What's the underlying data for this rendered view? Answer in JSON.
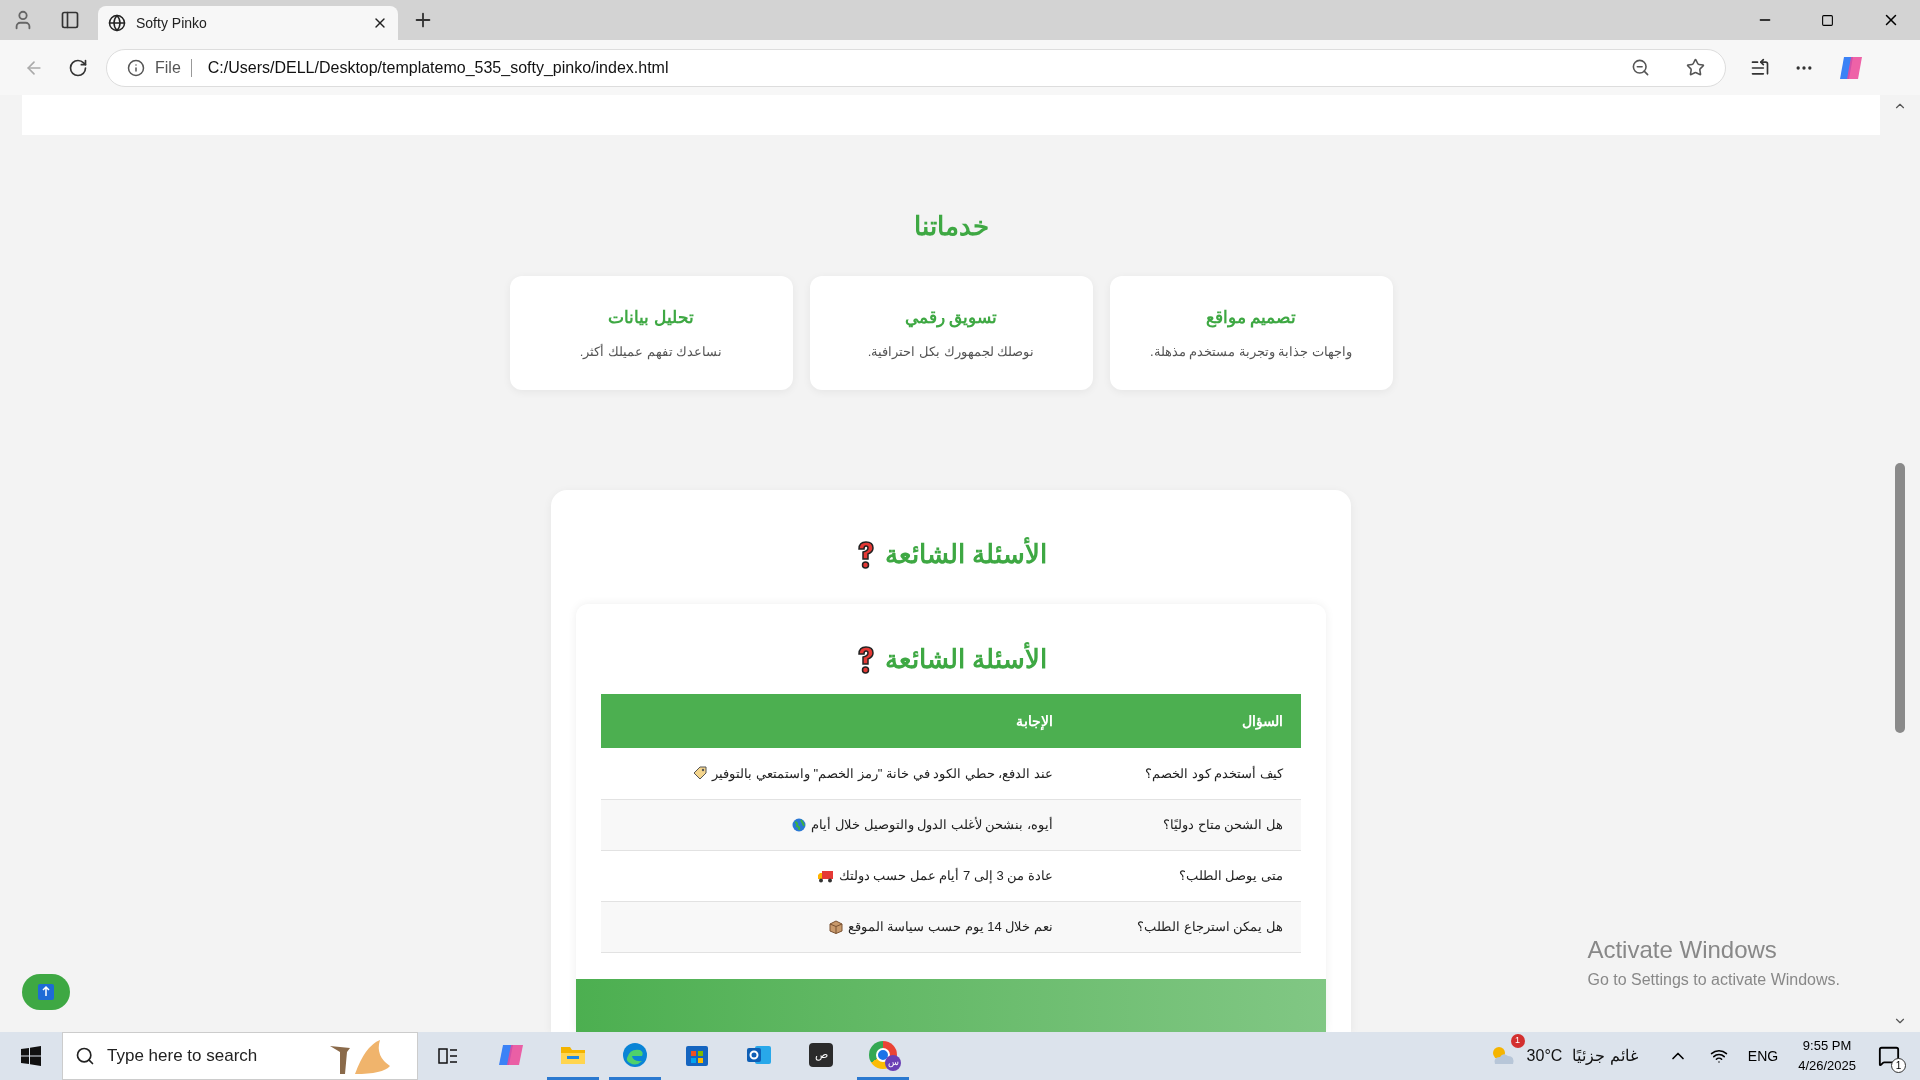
{
  "browser": {
    "tab_title": "Softy Pinko",
    "address_prefix": "File",
    "url": "C:/Users/DELL/Desktop/templatemo_535_softy_pinko/index.html"
  },
  "services": {
    "title": "خدماتنا",
    "cards": [
      {
        "title": "تصميم مواقع",
        "text": "واجهات جذابة وتجربة مستخدم مذهلة."
      },
      {
        "title": "تسويق رقمي",
        "text": "نوصلك لجمهورك بكل احترافية."
      },
      {
        "title": "تحليل بيانات",
        "text": "نساعدك تفهم عميلك أكثر."
      }
    ]
  },
  "faq": {
    "outer_title": "الأسئلة الشائعة",
    "inner_title": "الأسئلة الشائعة",
    "columns": [
      "السؤال",
      "الإجابة"
    ],
    "rows": [
      {
        "question": "كيف أستخدم كود الخصم؟",
        "answer": "عند الدفع، حطي الكود في خانة \"رمز الخصم\" واستمتعي بالتوفير"
      },
      {
        "question": "هل الشحن متاح دوليًا؟",
        "answer": "أيوه، بنشحن لأغلب الدول والتوصيل خلال أيام"
      },
      {
        "question": "متى يوصل الطلب؟",
        "answer": "عادة من 3 إلى 7 أيام عمل حسب دولتك"
      },
      {
        "question": "هل يمكن استرجاع الطلب؟",
        "answer": "نعم خلال 14 يوم حسب سياسة الموقع"
      }
    ]
  },
  "activation": {
    "title": "Activate Windows",
    "text": "Go to Settings to activate Windows."
  },
  "taskbar": {
    "search_placeholder": "Type here to search",
    "apps": [
      {
        "kind": "copilot",
        "active": false
      },
      {
        "kind": "explorer",
        "active": true
      },
      {
        "kind": "edge",
        "active": true
      },
      {
        "kind": "store",
        "active": false
      },
      {
        "kind": "outlook",
        "active": false
      },
      {
        "kind": "letter",
        "label": "ص",
        "active": false
      },
      {
        "kind": "chrome",
        "label": "س",
        "active": true
      }
    ],
    "weather": {
      "badge": "1",
      "temp": "30°C",
      "condition": "غائم جزئيًا"
    },
    "language": "ENG",
    "time": "9:55 PM",
    "date": "4/26/2025",
    "notification_count": "1"
  }
}
